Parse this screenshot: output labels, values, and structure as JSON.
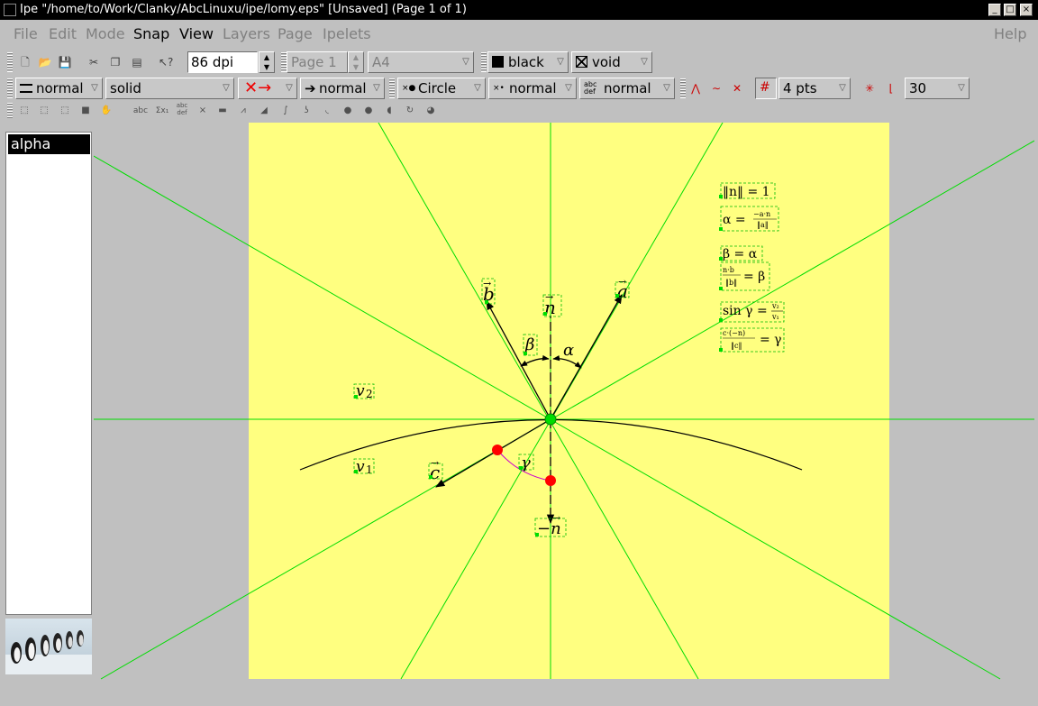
{
  "window": {
    "title": "Ipe \"/home/to/Work/Clanky/AbcLinuxu/ipe/lomy.eps\" [Unsaved] (Page 1 of 1)",
    "buttons": [
      "_",
      "□",
      "×"
    ]
  },
  "menubar": {
    "file": "File",
    "edit": "Edit",
    "mode": "Mode",
    "snap": "Snap",
    "view": "View",
    "layers": "Layers",
    "page": "Page",
    "ipelets": "Ipelets",
    "help": "Help"
  },
  "toolbar1": {
    "zoom": "86 dpi",
    "page": "Page 1",
    "paper": "A4",
    "stroke_color": "black",
    "fill_color": "void"
  },
  "toolbar2": {
    "pen_width": "normal",
    "dash": "solid",
    "arrow_size": "normal",
    "mark_shape": "Circle",
    "mark_size": "normal",
    "text_size": "normal",
    "snap_distance": "4 pts",
    "angle": "30"
  },
  "toolbar3": {
    "text_tool": "abc",
    "math_tool": "Σx₁",
    "para_tool": "abc def"
  },
  "layers_panel": {
    "items": [
      "alpha"
    ]
  },
  "colors": {
    "page": "#ffff80",
    "canvas_bg": "#c0c0c0",
    "guide": "#00dd00",
    "selection": "#00cc00",
    "mark_red": "#ff0000",
    "arc_magenta": "#cc00cc"
  },
  "drawing": {
    "labels": {
      "b": "b",
      "n": "n",
      "a": "a",
      "beta": "β",
      "alpha": "α",
      "v2": "v",
      "v2_sub": "2",
      "v1": "v",
      "v1_sub": "1",
      "c": "c",
      "gamma": "γ",
      "neg_n": "−n"
    },
    "formulas": {
      "f1": "‖n‖ = 1",
      "f2a": "α =",
      "f2_num": "−a·n",
      "f2_den": "‖a‖",
      "f3": "β = α",
      "f4_num": "n·b",
      "f4_den": "‖b‖",
      "f4_rhs": "= β",
      "f5a": "sin γ =",
      "f5_num": "v₂",
      "f5_den": "v₁",
      "f6_num": "c·(−n)",
      "f6_den": "‖c‖",
      "f6_rhs": "= γ"
    }
  }
}
